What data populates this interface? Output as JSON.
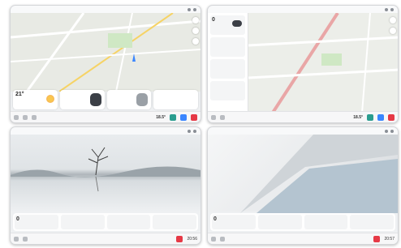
{
  "screens": [
    {
      "id": "navigation-map",
      "statusbar_title": "",
      "cards": [
        {
          "value": "21°",
          "sub": ""
        },
        {
          "value": "",
          "sub": ""
        },
        {
          "value": "",
          "sub": ""
        },
        {
          "value": "",
          "sub": ""
        }
      ],
      "dock_temp": "18.5°",
      "dock_time": ""
    },
    {
      "id": "navigation-sidepanel",
      "statusbar_title": "",
      "side_items": [
        {
          "value": "0",
          "sub": ""
        },
        {
          "value": "",
          "sub": ""
        },
        {
          "value": "",
          "sub": ""
        },
        {
          "value": "",
          "sub": ""
        }
      ],
      "dock_temp": "18.5°",
      "dock_time": ""
    },
    {
      "id": "lake-wallpaper",
      "tiles": [
        {
          "value": "0",
          "sub": ""
        },
        {
          "value": "",
          "sub": ""
        },
        {
          "value": "",
          "sub": ""
        },
        {
          "value": "",
          "sub": ""
        }
      ],
      "dock_temp": "",
      "dock_time": "20:56"
    },
    {
      "id": "architecture-wallpaper",
      "tiles": [
        {
          "value": "0",
          "sub": ""
        },
        {
          "value": "",
          "sub": ""
        },
        {
          "value": "",
          "sub": ""
        },
        {
          "value": "",
          "sub": ""
        }
      ],
      "dock_temp": "",
      "dock_time": "20:57"
    }
  ],
  "colors": {
    "accent_red": "#e63946",
    "accent_green": "#2a9d8f",
    "accent_blue": "#3a86ff"
  }
}
